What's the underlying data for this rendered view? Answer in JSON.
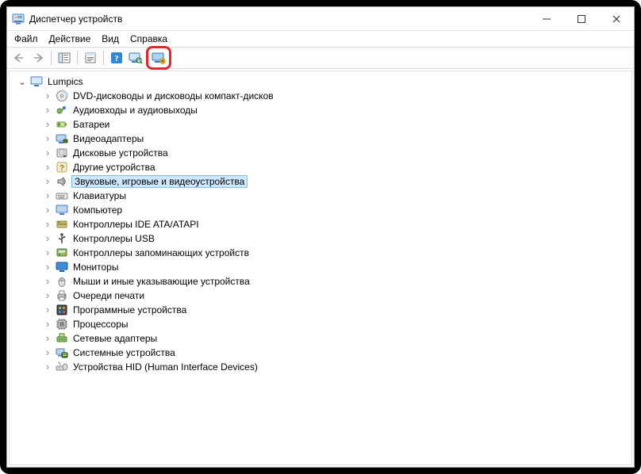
{
  "window": {
    "title": "Диспетчер устройств"
  },
  "menu": {
    "file": "Файл",
    "action": "Действие",
    "view": "Вид",
    "help": "Справка"
  },
  "toolbar": {
    "back": "back",
    "forward": "forward",
    "show_hide_tree": "show-hide-console-tree",
    "properties": "properties",
    "help": "help",
    "scan": "scan-hardware",
    "add_legacy": "add-legacy-hardware-highlighted"
  },
  "tree": {
    "root": {
      "label": "Lumpics",
      "expanded": true
    },
    "items": [
      {
        "label": "DVD-дисководы и дисководы компакт-дисков",
        "icon": "disc",
        "selected": false
      },
      {
        "label": "Аудиовходы и аудиовыходы",
        "icon": "audio-jack",
        "selected": false
      },
      {
        "label": "Батареи",
        "icon": "battery",
        "selected": false
      },
      {
        "label": "Видеоадаптеры",
        "icon": "display-adapter",
        "selected": false
      },
      {
        "label": "Дисковые устройства",
        "icon": "disk",
        "selected": false
      },
      {
        "label": "Другие устройства",
        "icon": "unknown",
        "selected": false
      },
      {
        "label": "Звуковые, игровые и видеоустройства",
        "icon": "sound",
        "selected": true
      },
      {
        "label": "Клавиатуры",
        "icon": "keyboard",
        "selected": false
      },
      {
        "label": "Компьютер",
        "icon": "computer",
        "selected": false
      },
      {
        "label": "Контроллеры IDE ATA/ATAPI",
        "icon": "ide",
        "selected": false
      },
      {
        "label": "Контроллеры USB",
        "icon": "usb",
        "selected": false
      },
      {
        "label": "Контроллеры запоминающих устройств",
        "icon": "storage",
        "selected": false
      },
      {
        "label": "Мониторы",
        "icon": "monitor",
        "selected": false
      },
      {
        "label": "Мыши и иные указывающие устройства",
        "icon": "mouse",
        "selected": false
      },
      {
        "label": "Очереди печати",
        "icon": "printer",
        "selected": false
      },
      {
        "label": "Программные устройства",
        "icon": "software",
        "selected": false
      },
      {
        "label": "Процессоры",
        "icon": "cpu",
        "selected": false
      },
      {
        "label": "Сетевые адаптеры",
        "icon": "network",
        "selected": false
      },
      {
        "label": "Системные устройства",
        "icon": "system",
        "selected": false
      },
      {
        "label": "Устройства HID (Human Interface Devices)",
        "icon": "hid",
        "selected": false
      }
    ]
  }
}
